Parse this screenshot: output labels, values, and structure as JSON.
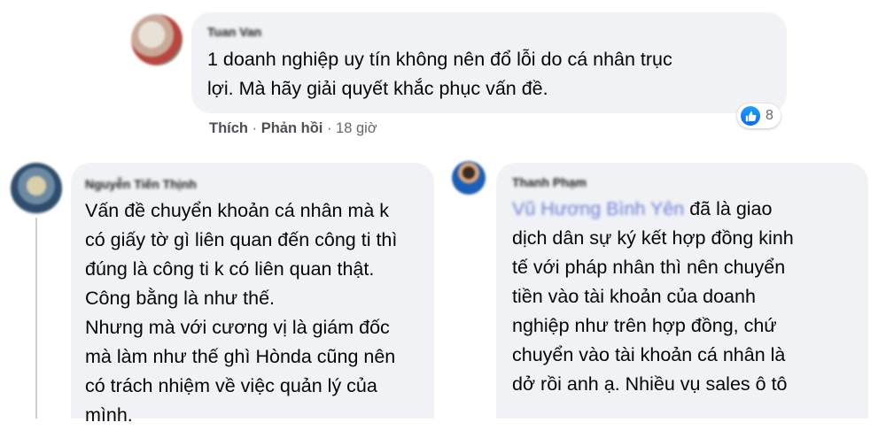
{
  "comments": [
    {
      "author": "Tuan Van",
      "text": "1 doanh nghiệp uy tín không nên đổ lỗi do cá nhân trục\nlợi. Mà hãy giải quyết khắc phục vấn đề.",
      "actions": {
        "like_label": "Thích",
        "reply_label": "Phản hồi",
        "time": "18 giờ"
      },
      "reaction_count": "8"
    },
    {
      "author": "Nguyễn Tiến Thịnh",
      "text": "Vấn đề chuyển khoản cá nhân mà k\ncó giấy tờ gì liên quan đến công ti thì\nđúng là công ti k có liên quan thật.\nCông bằng là như thế.\nNhưng mà với cương vị là giám đốc\nmà làm như thế ghì Hònda cũng nên\ncó trách nhiệm về việc quản lý của\nmình."
    },
    {
      "author": "Thanh Phạm",
      "mention": "Vũ Hương Bình Yên",
      "text": " đã là giao\ndịch dân sự ký kết hợp đồng kinh\ntế với pháp nhân thì nên chuyển\ntiền vào tài khoản của doanh\nnghiệp như trên hợp đồng, chứ\nchuyển vào tài khoản cá nhân là\ndở rồi anh ạ. Nhiều vụ sales ô tô"
    }
  ],
  "colors": {
    "bubble": "#f0f2f5",
    "meta_text": "#65676b",
    "like_blue": "#0866ff",
    "mention": "#6f7fd9"
  }
}
